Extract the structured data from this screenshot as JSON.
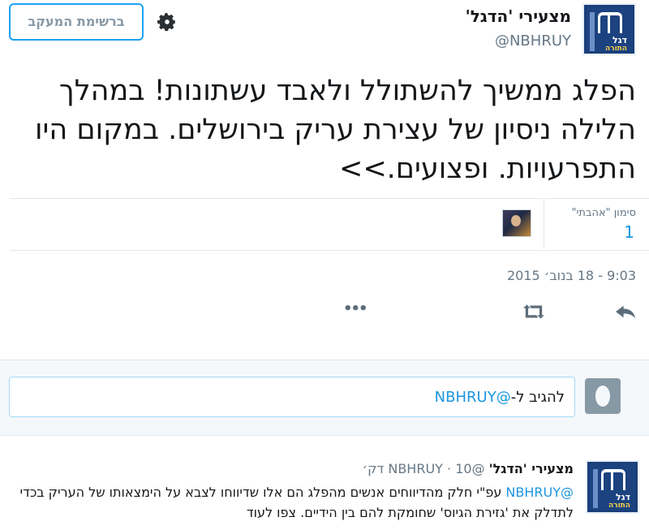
{
  "tweet": {
    "display_name": "מצעירי 'הדגל'",
    "handle": "@NBHRUY",
    "text": "הפלג ממשיך להשתולל ולאבד עשתונות! במהלך הלילה ניסיון של עצירת עריק בירושלים. במקום היו התפרעויות. ופצועים.>>",
    "likes_label": "סימון \"אהבתי\"",
    "likes_count": "1",
    "timestamp": "9:03 - 18 בנוב׳ 2015",
    "logo_text_main": "דגל",
    "logo_text_sub": "התורה"
  },
  "header": {
    "follow_button_label": "ברשימת המעקב"
  },
  "actions": {
    "reply_icon": "reply-icon",
    "retweet_icon": "retweet-icon",
    "more_icon": "more-icon",
    "more_label": "•••"
  },
  "reply_box": {
    "prefix": "להגיב ל-",
    "mention": "@NBHRUY"
  },
  "reply_tweet": {
    "display_name": "מצעירי 'הדגל'",
    "handle": "@NBHRUY",
    "separator": "·",
    "time": "10 דק׳",
    "mention": "@NBHRUY",
    "text": " עפ\"י חלק מהדיווחים אנשים מהפלג הם אלו שדיווחו לצבא על הימצאותו של העריק בכדי לתדלק את 'גזירת הגיוס' שחומקת להם בין הידיים. צפו לעוד"
  },
  "colors": {
    "accent": "#1da1f2",
    "link": "#1b95e0",
    "muted": "#657786",
    "logo_blue": "#1a3f7a"
  }
}
